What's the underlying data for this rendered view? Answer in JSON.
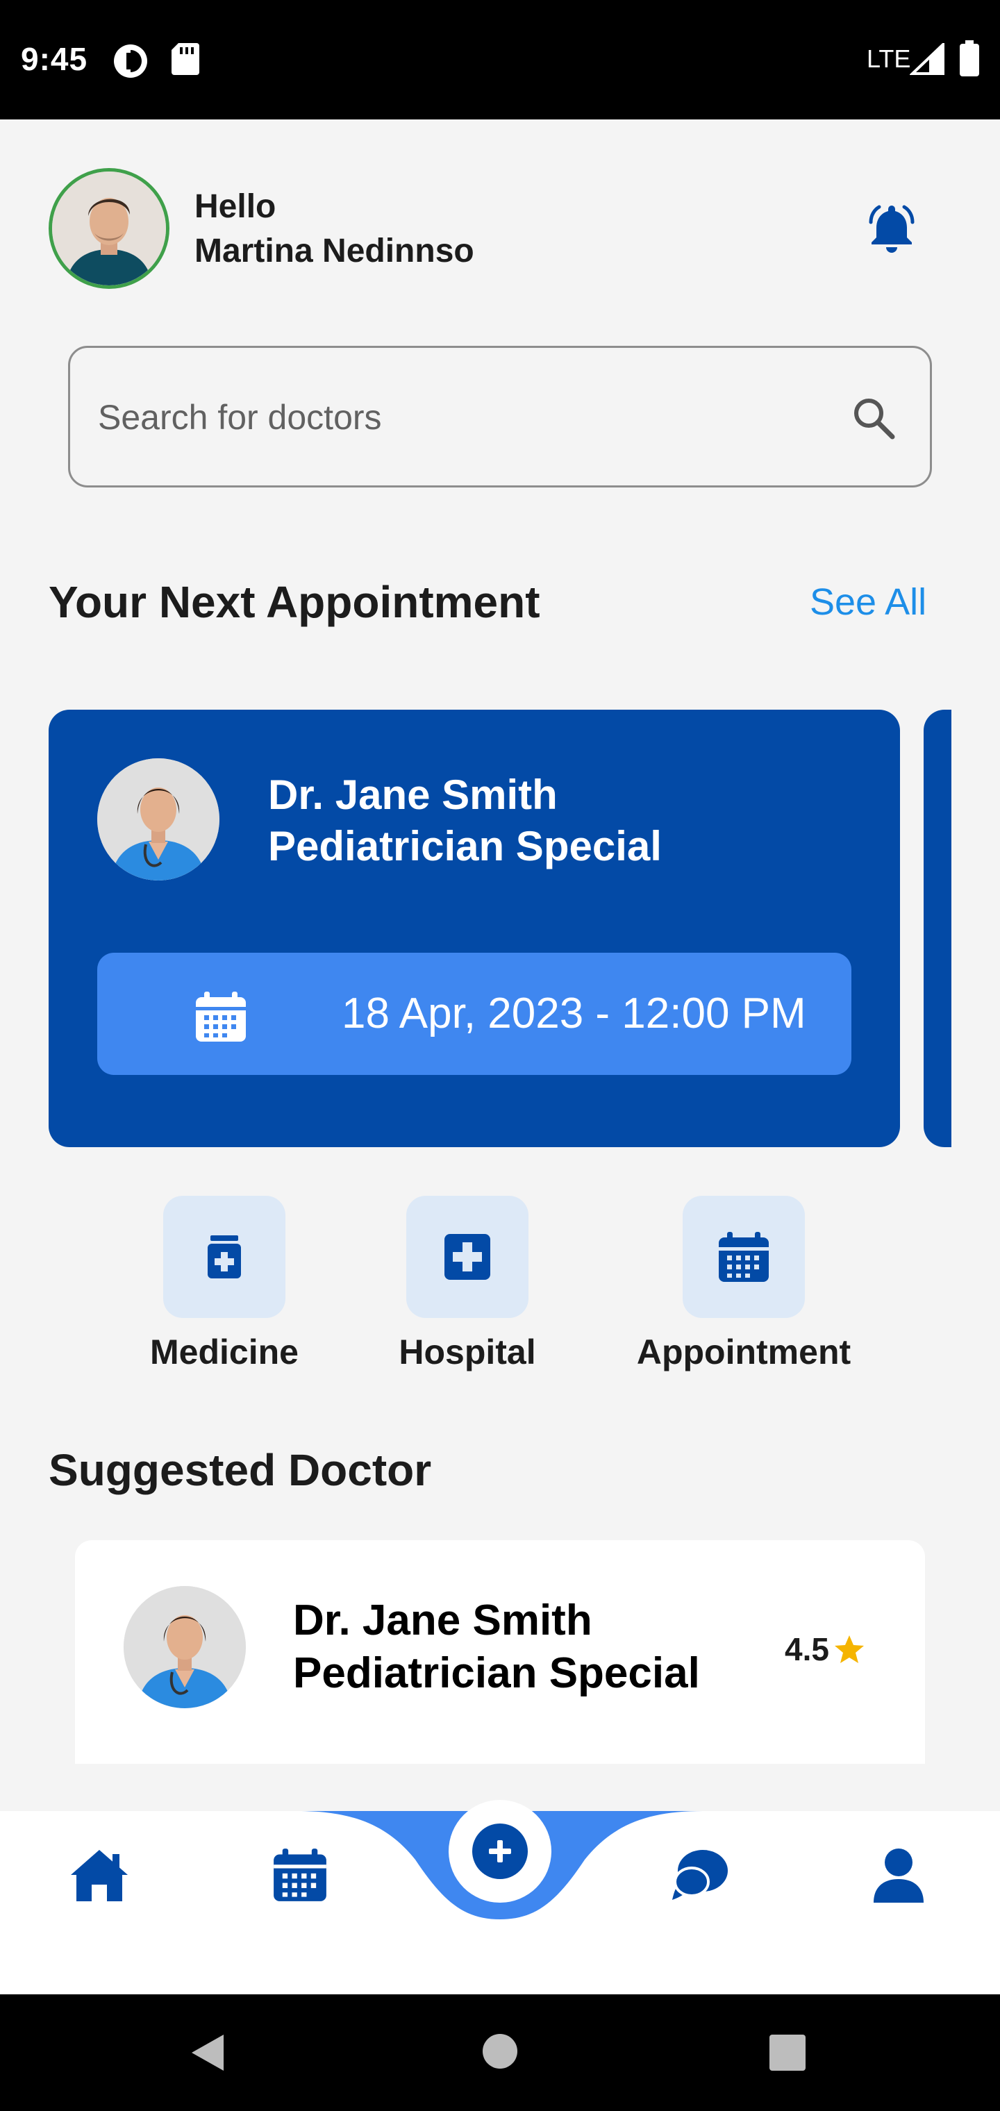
{
  "status_bar": {
    "time": "9:45",
    "network": "LTE"
  },
  "header": {
    "greeting": "Hello",
    "user_name": "Martina Nedinnso"
  },
  "search": {
    "placeholder": "Search for doctors"
  },
  "next_appointment": {
    "title": "Your Next Appointment",
    "see_all_label": "See All",
    "doctor_name": "Dr. Jane Smith",
    "doctor_specialty": "Pediatrician Special",
    "datetime": "18 Apr, 2023 - 12:00 PM"
  },
  "quick_actions": [
    {
      "label": "Medicine",
      "icon": "medicine-bottle-icon"
    },
    {
      "label": "Hospital",
      "icon": "hospital-cross-icon"
    },
    {
      "label": "Appointment",
      "icon": "calendar-icon"
    }
  ],
  "suggested": {
    "title": "Suggested Doctor",
    "doctor_name": "Dr. Jane Smith",
    "doctor_specialty": "Pediatrician Special",
    "rating": "4.5"
  },
  "bottom_nav": [
    {
      "name": "home",
      "icon": "home-icon"
    },
    {
      "name": "calendar",
      "icon": "calendar-icon"
    },
    {
      "name": "add",
      "icon": "plus-circle-icon"
    },
    {
      "name": "chat",
      "icon": "chat-bubbles-icon"
    },
    {
      "name": "profile",
      "icon": "person-icon"
    }
  ],
  "colors": {
    "primary": "#034aa6",
    "accent": "#3f87f0",
    "link": "#1d8ee8",
    "tile_bg": "#dde9f7",
    "star": "#f5b400",
    "avatar_ring": "#3fa04a"
  }
}
